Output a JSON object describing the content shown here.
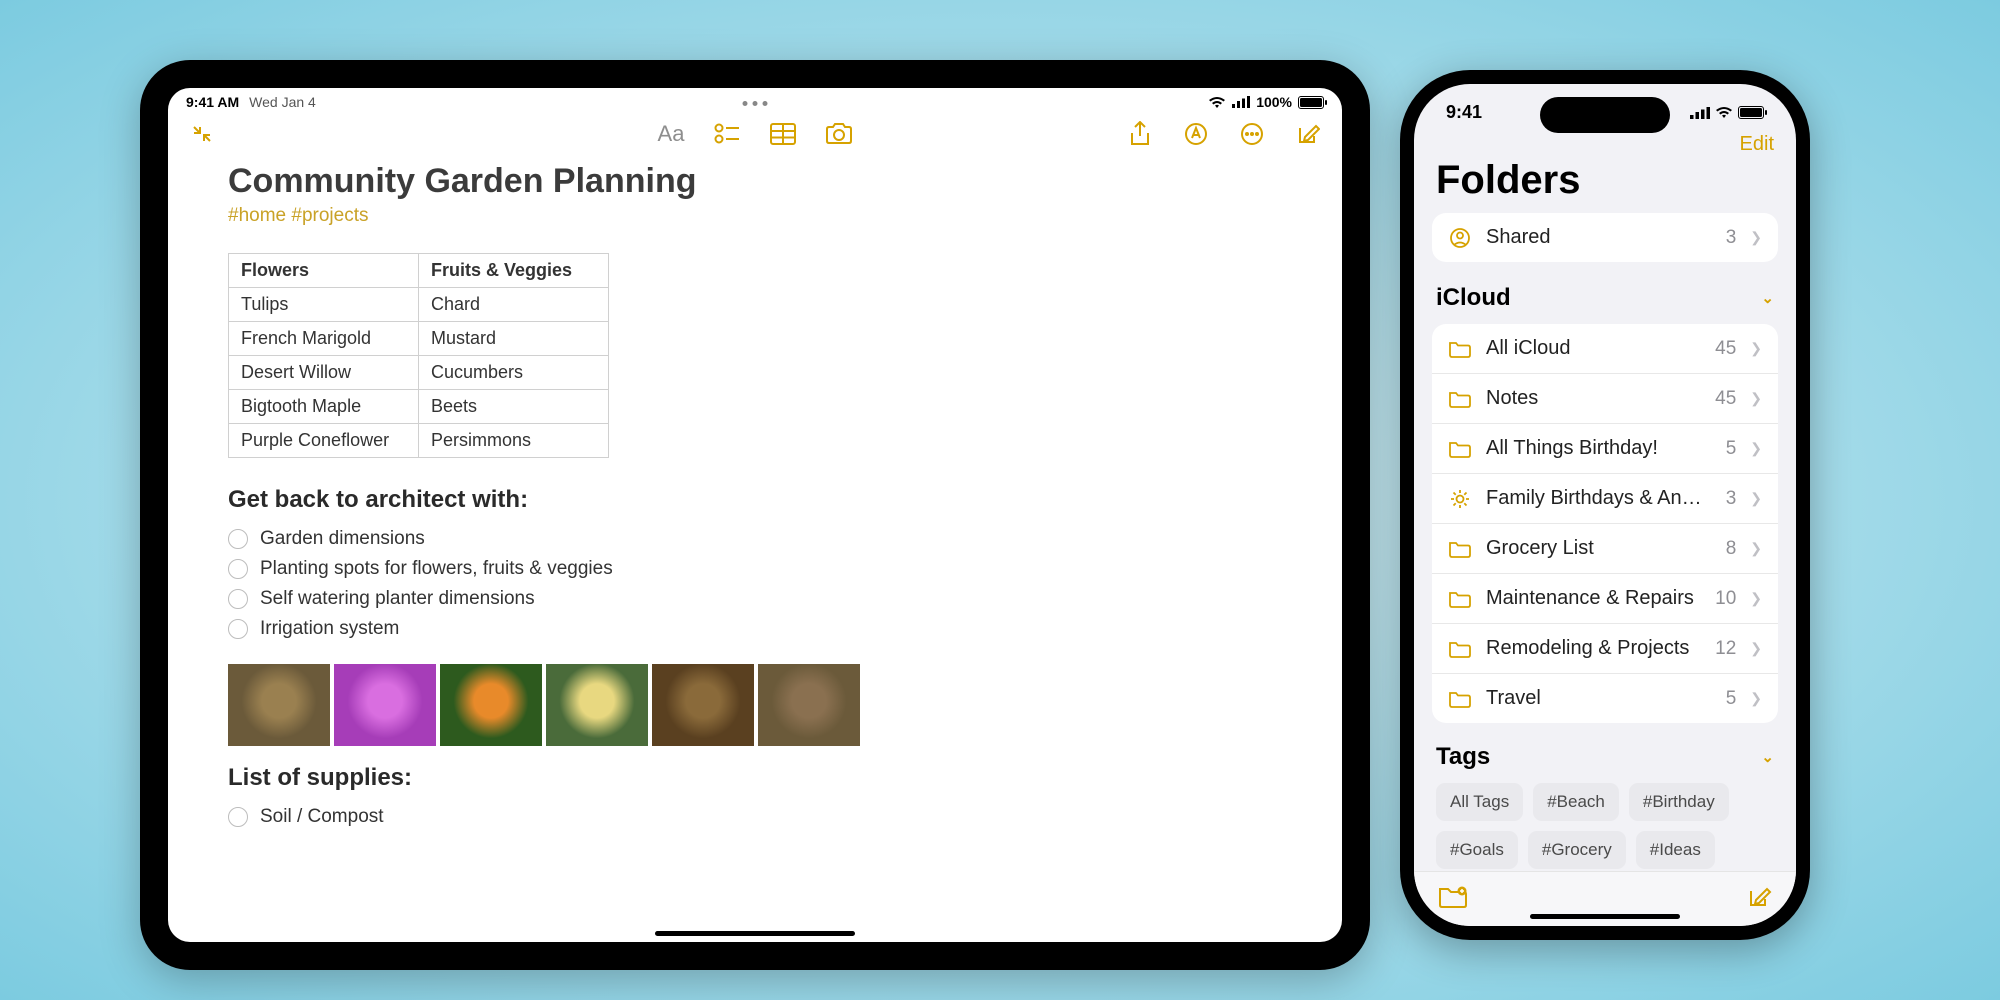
{
  "ipad": {
    "status": {
      "time": "9:41 AM",
      "date": "Wed Jan 4",
      "battery": "100%"
    },
    "note": {
      "title": "Community Garden Planning",
      "tags": "#home #projects",
      "table": {
        "headers": [
          "Flowers",
          "Fruits & Veggies"
        ],
        "rows": [
          [
            "Tulips",
            "Chard"
          ],
          [
            "French Marigold",
            "Mustard"
          ],
          [
            "Desert Willow",
            "Cucumbers"
          ],
          [
            "Bigtooth Maple",
            "Beets"
          ],
          [
            "Purple Coneflower",
            "Persimmons"
          ]
        ]
      },
      "architectHeading": "Get back to architect with:",
      "architectItems": [
        "Garden dimensions",
        "Planting spots for flowers, fruits & veggies",
        "Self watering planter dimensions",
        "Irrigation system"
      ],
      "suppliesHeading": "List of supplies:",
      "suppliesItems": [
        "Soil / Compost"
      ]
    }
  },
  "iphone": {
    "status": {
      "time": "9:41"
    },
    "editLabel": "Edit",
    "foldersTitle": "Folders",
    "shared": {
      "label": "Shared",
      "count": "3"
    },
    "icloudHeader": "iCloud",
    "folders": [
      {
        "icon": "folder",
        "label": "All iCloud",
        "count": "45"
      },
      {
        "icon": "folder",
        "label": "Notes",
        "count": "45"
      },
      {
        "icon": "folder",
        "label": "All Things Birthday!",
        "count": "5"
      },
      {
        "icon": "gear",
        "label": "Family Birthdays & Anniversaries",
        "count": "3"
      },
      {
        "icon": "folder",
        "label": "Grocery List",
        "count": "8"
      },
      {
        "icon": "folder",
        "label": "Maintenance & Repairs",
        "count": "10"
      },
      {
        "icon": "folder",
        "label": "Remodeling & Projects",
        "count": "12"
      },
      {
        "icon": "folder",
        "label": "Travel",
        "count": "5"
      }
    ],
    "tagsHeader": "Tags",
    "tags": [
      "All Tags",
      "#Beach",
      "#Birthday",
      "#Goals",
      "#Grocery",
      "#Ideas"
    ]
  },
  "thumbColors": [
    [
      "#6b5a3a",
      "#9a8050"
    ],
    [
      "#a63db8",
      "#d96ee0"
    ],
    [
      "#2d5a1e",
      "#e88a2a"
    ],
    [
      "#4a6b3a",
      "#e8d880"
    ],
    [
      "#5a4020",
      "#8a6a3a"
    ],
    [
      "#6b5a3a",
      "#8a7050"
    ]
  ]
}
